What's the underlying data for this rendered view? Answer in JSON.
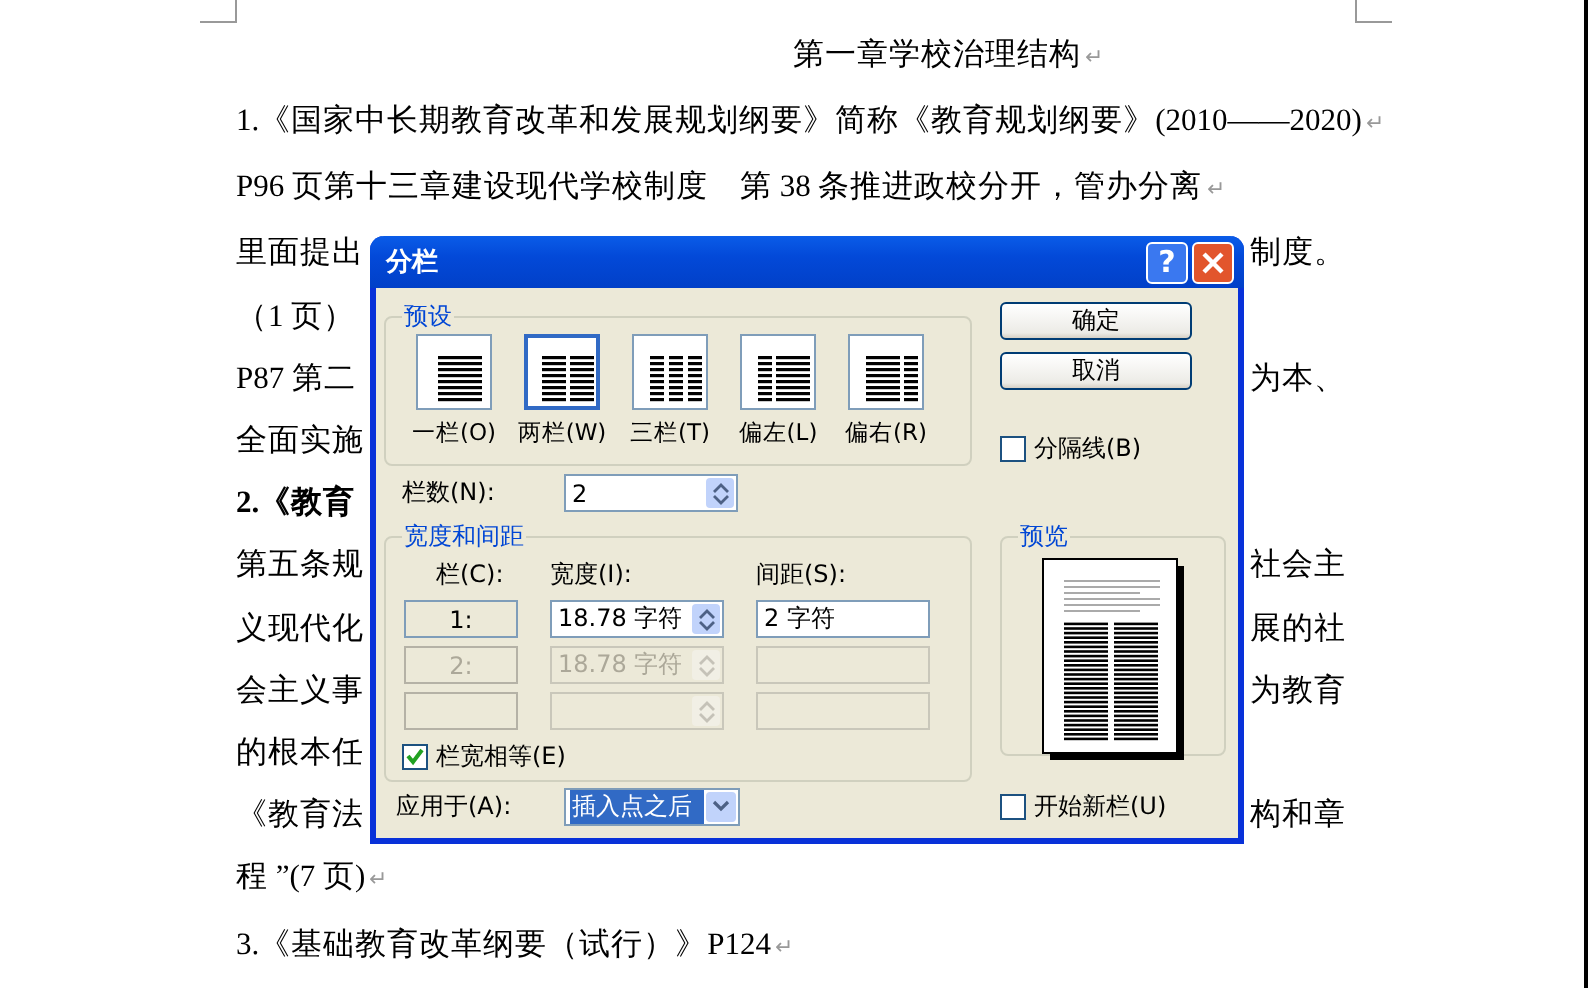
{
  "document": {
    "title": "第一章学校治理结构",
    "title_mark": "↵",
    "lines": [
      {
        "left": "1.《国家中长期教育改革和发展规划纲要》简称《教育规划纲要》(2010——2020)",
        "bold": false,
        "mark": "↵"
      },
      {
        "left": "P96 页第十三章建设现代学校制度　第 38 条推进政校分开，管办分离",
        "bold": false,
        "mark": "↵"
      },
      {
        "left": "里面提出",
        "right": "制度。",
        "bold": false
      },
      {
        "left": "（1 页）",
        "bold": false
      },
      {
        "left": "P87 第二",
        "right": "为本、",
        "bold": false
      },
      {
        "left": "全面实施",
        "bold": false
      },
      {
        "left": "2.《教育",
        "bold": true
      },
      {
        "left": "第五条规",
        "right": "社会主",
        "bold": false
      },
      {
        "left": "义现代化",
        "right": "展的社",
        "bold": false
      },
      {
        "left": "会主义事",
        "right": "为教育",
        "bold": false
      },
      {
        "left": "的根本任",
        "bold": false
      },
      {
        "left": "《教育法",
        "right": "构和章",
        "bold": false
      },
      {
        "left": "程 ”(7 页)",
        "bold": false,
        "mark": "↵"
      },
      {
        "left": "3.《基础教育改革纲要（试行）》P124",
        "bold": false,
        "mark": "↵"
      }
    ]
  },
  "dialog": {
    "title": "分栏",
    "help_button": "?",
    "presets": {
      "label": "预设",
      "items": [
        {
          "label": "一栏(O)",
          "kind": "one",
          "selected": false
        },
        {
          "label": "两栏(W)",
          "kind": "two",
          "selected": true
        },
        {
          "label": "三栏(T)",
          "kind": "three",
          "selected": false
        },
        {
          "label": "偏左(L)",
          "kind": "left",
          "selected": false
        },
        {
          "label": "偏右(R)",
          "kind": "right",
          "selected": false
        }
      ]
    },
    "buttons": [
      "确定",
      "取消"
    ],
    "line_between": {
      "label": "分隔线(B)",
      "checked": false
    },
    "number_of_columns": {
      "label": "栏数(N):",
      "value": "2"
    },
    "width_and_spacing": {
      "label": "宽度和间距",
      "headers": [
        "栏(C):",
        "宽度(I):",
        "间距(S):"
      ],
      "rows": [
        {
          "column": "1:",
          "width": "18.78 字符",
          "spacing": "2 字符",
          "disabled": false
        },
        {
          "column": "2:",
          "width": "18.78 字符",
          "disabled": true
        },
        {
          "disabled": true
        }
      ]
    },
    "equal_column_width": {
      "label": "栏宽相等(E)",
      "checked": true
    },
    "preview": {
      "label": "预览"
    },
    "apply_to": {
      "label": "应用于(A):",
      "value": "插入点之后"
    },
    "start_new_column": {
      "label": "开始新栏(U)",
      "checked": false
    }
  }
}
